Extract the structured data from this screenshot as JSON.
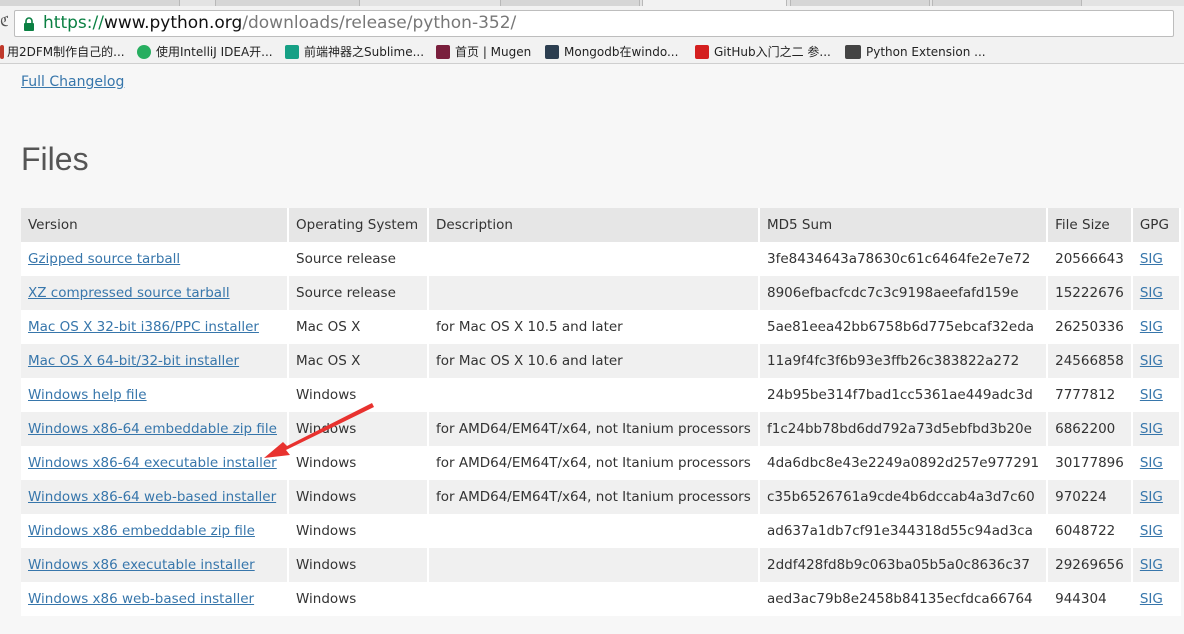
{
  "browser": {
    "url": {
      "scheme": "https://",
      "host": "www.python.org",
      "path": "/downloads/release/python-352/"
    },
    "bookmarks": [
      {
        "label": "用2DFM制作自己的...",
        "icon": "bookmark-favicon-red",
        "color": "#c0392b"
      },
      {
        "label": "使用IntelliJ IDEA开...",
        "icon": "bookmark-favicon-c",
        "color": "#27ae60"
      },
      {
        "label": "前端神器之Sublime...",
        "icon": "bookmark-favicon-z",
        "color": "#16a085"
      },
      {
        "label": "首页 | Mugen",
        "icon": "bookmark-favicon-m",
        "color": "#7a1f3d"
      },
      {
        "label": "Mongodb在windo...",
        "icon": "bookmark-favicon-g",
        "color": "#2c3e50"
      },
      {
        "label": "GitHub入门之二 参...",
        "icon": "bookmark-favicon-c-red",
        "color": "#d41f1f"
      },
      {
        "label": "Python Extension ...",
        "icon": "bookmark-favicon-lfd",
        "color": "#444444"
      }
    ]
  },
  "page": {
    "changelog_link": "Full Changelog",
    "heading": "Files",
    "table": {
      "headers": [
        "Version",
        "Operating System",
        "Description",
        "MD5 Sum",
        "File Size",
        "GPG"
      ],
      "rows": [
        {
          "version": "Gzipped source tarball",
          "os": "Source release",
          "description": "",
          "md5": "3fe8434643a78630c61c6464fe2e7e72",
          "size": "20566643",
          "gpg": "SIG"
        },
        {
          "version": "XZ compressed source tarball",
          "os": "Source release",
          "description": "",
          "md5": "8906efbacfcdc7c3c9198aeefafd159e",
          "size": "15222676",
          "gpg": "SIG"
        },
        {
          "version": "Mac OS X 32-bit i386/PPC installer",
          "os": "Mac OS X",
          "description": "for Mac OS X 10.5 and later",
          "md5": "5ae81eea42bb6758b6d775ebcaf32eda",
          "size": "26250336",
          "gpg": "SIG"
        },
        {
          "version": "Mac OS X 64-bit/32-bit installer",
          "os": "Mac OS X",
          "description": "for Mac OS X 10.6 and later",
          "md5": "11a9f4fc3f6b93e3ffb26c383822a272",
          "size": "24566858",
          "gpg": "SIG"
        },
        {
          "version": "Windows help file",
          "os": "Windows",
          "description": "",
          "md5": "24b95be314f7bad1cc5361ae449adc3d",
          "size": "7777812",
          "gpg": "SIG"
        },
        {
          "version": "Windows x86-64 embeddable zip file",
          "os": "Windows",
          "description": "for AMD64/EM64T/x64, not Itanium processors",
          "md5": "f1c24bb78bd6dd792a73d5ebfbd3b20e",
          "size": "6862200",
          "gpg": "SIG"
        },
        {
          "version": "Windows x86-64 executable installer",
          "os": "Windows",
          "description": "for AMD64/EM64T/x64, not Itanium processors",
          "md5": "4da6dbc8e43e2249a0892d257e977291",
          "size": "30177896",
          "gpg": "SIG"
        },
        {
          "version": "Windows x86-64 web-based installer",
          "os": "Windows",
          "description": "for AMD64/EM64T/x64, not Itanium processors",
          "md5": "c35b6526761a9cde4b6dccab4a3d7c60",
          "size": "970224",
          "gpg": "SIG"
        },
        {
          "version": "Windows x86 embeddable zip file",
          "os": "Windows",
          "description": "",
          "md5": "ad637a1db7cf91e344318d55c94ad3ca",
          "size": "6048722",
          "gpg": "SIG"
        },
        {
          "version": "Windows x86 executable installer",
          "os": "Windows",
          "description": "",
          "md5": "2ddf428fd8b9c063ba05b5a0c8636c37",
          "size": "29269656",
          "gpg": "SIG"
        },
        {
          "version": "Windows x86 web-based installer",
          "os": "Windows",
          "description": "",
          "md5": "aed3ac79b8e2458b84135ecfdca66764",
          "size": "944304",
          "gpg": "SIG"
        }
      ]
    },
    "annotation": {
      "icon": "red-arrow-annotation",
      "color": "#e8322f",
      "points_to_row": 6
    }
  },
  "colors": {
    "link": "#3776ab",
    "secure": "#0b8043"
  }
}
